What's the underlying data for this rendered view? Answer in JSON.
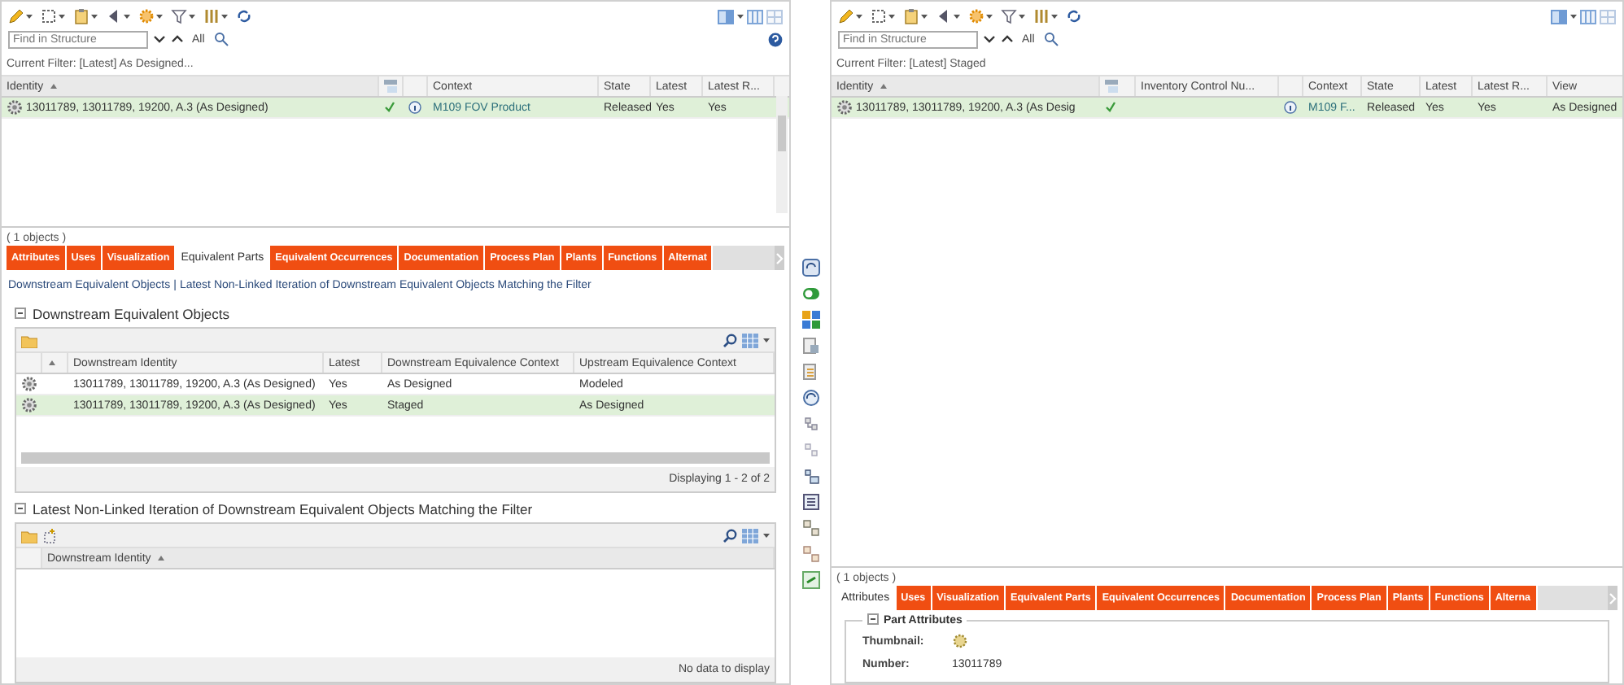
{
  "panes": [
    {
      "search": {
        "placeholder": "Find in Structure"
      },
      "find_all": "All",
      "filter": "Current Filter: [Latest] As Designed...",
      "table": {
        "columns": [
          {
            "kind": "text",
            "label": "Identity",
            "sorted": true
          },
          {
            "kind": "status"
          },
          {
            "kind": "info"
          },
          {
            "kind": "link",
            "label": "Context",
            "sorted": false
          },
          {
            "kind": "text",
            "label": "State",
            "sorted": false
          },
          {
            "kind": "text",
            "label": "Latest",
            "sorted": false
          },
          {
            "kind": "text",
            "label": "Latest R...",
            "sorted": false
          }
        ],
        "rows": [
          {
            "selected": true,
            "checked": true,
            "cells": [
              "13011789, 13011789, 19200, A.3 (As Designed)",
              "",
              "",
              "M109 FOV Product",
              "Released",
              "Yes",
              "Yes"
            ]
          }
        ]
      },
      "object_count": "( 1 objects )",
      "tabs": [
        {
          "label": "Attributes",
          "selected": false
        },
        {
          "label": "Uses",
          "selected": false
        },
        {
          "label": "Visualization",
          "selected": false
        },
        {
          "label": "Equivalent Parts",
          "selected": true
        },
        {
          "label": "Equivalent Occurrences",
          "selected": false
        },
        {
          "label": "Documentation",
          "selected": false
        },
        {
          "label": "Process Plan",
          "selected": false
        },
        {
          "label": "Plants",
          "selected": false
        },
        {
          "label": "Functions",
          "selected": false
        },
        {
          "label": "Alternat",
          "selected": false
        }
      ],
      "content": {
        "kind": "equivalents",
        "links": [
          "Downstream Equivalent Objects",
          "Latest Non-Linked Iteration of Downstream Equivalent Objects Matching the Filter"
        ],
        "separator": "|",
        "sections": [
          {
            "title": "Downstream Equivalent Objects",
            "expanded": true,
            "columns": [
              {
                "kind": "icon"
              },
              {
                "kind": "sort",
                "sorted": true
              },
              {
                "kind": "text",
                "label": "Downstream Identity",
                "sorted": false
              },
              {
                "kind": "text",
                "label": "Latest",
                "sorted": false
              },
              {
                "kind": "text",
                "label": "Downstream Equivalence Context",
                "sorted": false
              },
              {
                "kind": "text",
                "label": "Upstream Equivalence Context",
                "sorted": false
              }
            ],
            "rows": [
              {
                "selected": false,
                "cells": [
                  "",
                  "",
                  "13011789, 13011789, 19200, A.3 (As Designed)",
                  "Yes",
                  "As Designed",
                  "Modeled"
                ]
              },
              {
                "selected": true,
                "cells": [
                  "",
                  "",
                  "13011789, 13011789, 19200, A.3 (As Designed)",
                  "Yes",
                  "Staged",
                  "As Designed"
                ]
              }
            ],
            "footer": "Displaying 1 - 2 of 2"
          },
          {
            "title": "Latest Non-Linked Iteration of Downstream Equivalent Objects Matching the Filter",
            "expanded": true,
            "columns": [
              {
                "kind": "icon"
              },
              {
                "kind": "text",
                "label": "Downstream Identity",
                "sorted": true
              }
            ],
            "footer": "No data to display"
          }
        ]
      }
    },
    {
      "search": {
        "placeholder": "Find in Structure"
      },
      "find_all": "All",
      "filter": "Current Filter: [Latest] Staged",
      "table": {
        "columns": [
          {
            "kind": "text",
            "label": "Identity",
            "sorted": true
          },
          {
            "kind": "status"
          },
          {
            "kind": "text",
            "label": "Inventory Control Nu...",
            "sorted": false
          },
          {
            "kind": "info"
          },
          {
            "kind": "link",
            "label": "Context",
            "sorted": false
          },
          {
            "kind": "text",
            "label": "State",
            "sorted": false
          },
          {
            "kind": "text",
            "label": "Latest",
            "sorted": false
          },
          {
            "kind": "text",
            "label": "Latest R...",
            "sorted": false
          },
          {
            "kind": "text",
            "label": "View",
            "sorted": false
          }
        ],
        "rows": [
          {
            "selected": true,
            "checked": true,
            "cells": [
              "13011789, 13011789, 19200, A.3 (As Desig",
              "",
              "",
              "",
              "M109 F...",
              "Released",
              "Yes",
              "Yes",
              "As Designed"
            ]
          }
        ]
      },
      "object_count": "( 1 objects )",
      "tabs": [
        {
          "label": "Attributes",
          "selected": true
        },
        {
          "label": "Uses",
          "selected": false
        },
        {
          "label": "Visualization",
          "selected": false
        },
        {
          "label": "Equivalent Parts",
          "selected": false
        },
        {
          "label": "Equivalent Occurrences",
          "selected": false
        },
        {
          "label": "Documentation",
          "selected": false
        },
        {
          "label": "Process Plan",
          "selected": false
        },
        {
          "label": "Plants",
          "selected": false
        },
        {
          "label": "Functions",
          "selected": false
        },
        {
          "label": "Alterna",
          "selected": false
        }
      ],
      "content": {
        "kind": "attributes",
        "group": {
          "title": "Part Attributes",
          "expanded": true,
          "fields": [
            {
              "kind": "thumbnail",
              "label": "Thumbnail:"
            },
            {
              "kind": "text",
              "label": "Number:",
              "value": "13011789"
            }
          ]
        }
      }
    }
  ]
}
